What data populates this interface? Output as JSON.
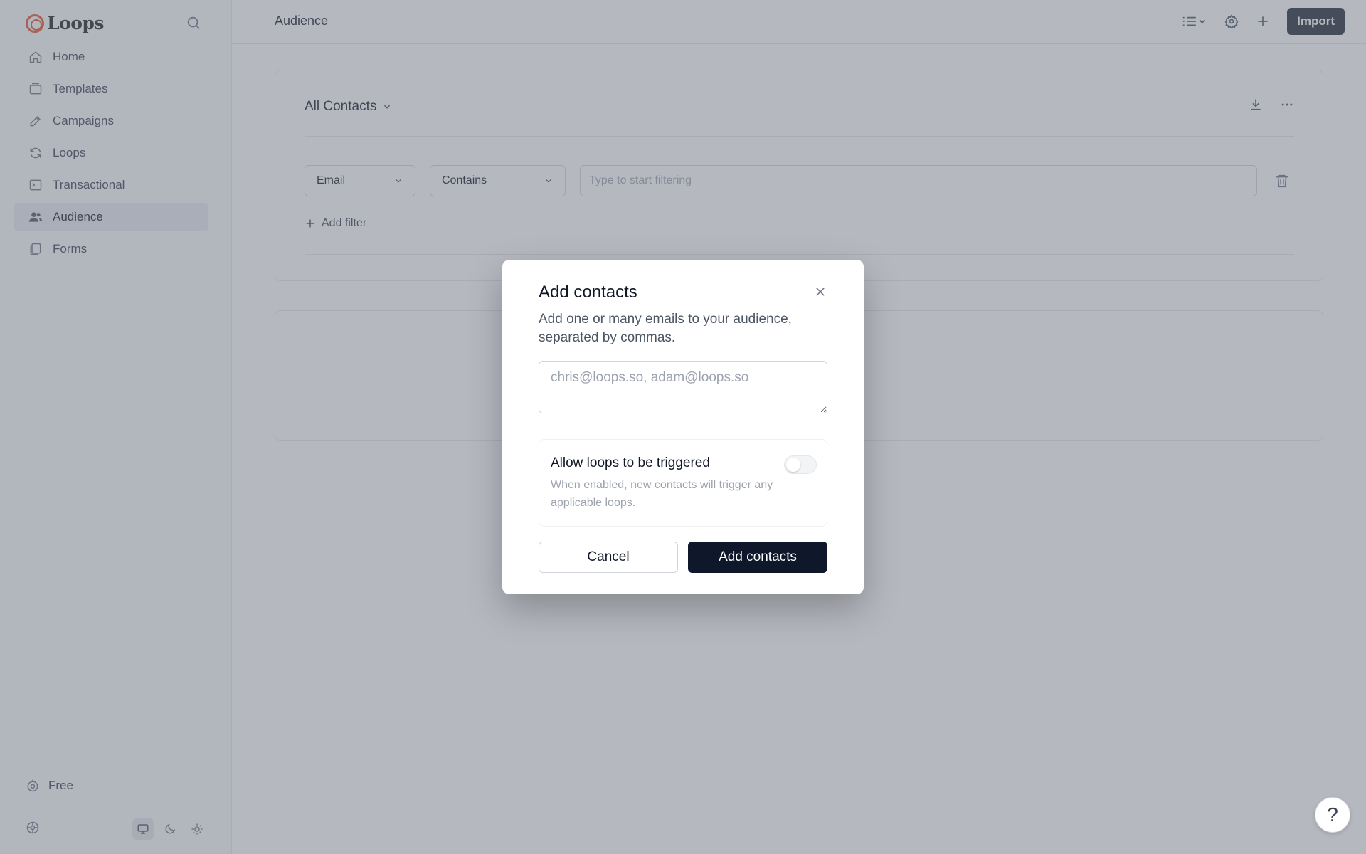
{
  "brand": {
    "name": "Loops"
  },
  "sidebar": {
    "items": [
      {
        "label": "Home",
        "icon": "home-icon"
      },
      {
        "label": "Templates",
        "icon": "templates-icon"
      },
      {
        "label": "Campaigns",
        "icon": "campaigns-icon"
      },
      {
        "label": "Loops",
        "icon": "loops-icon"
      },
      {
        "label": "Transactional",
        "icon": "transactional-icon"
      },
      {
        "label": "Audience",
        "icon": "audience-icon",
        "active": true
      },
      {
        "label": "Forms",
        "icon": "forms-icon"
      }
    ],
    "plan_label": "Free"
  },
  "header": {
    "title": "Audience",
    "import_label": "Import"
  },
  "main": {
    "view_title": "All Contacts",
    "filter": {
      "field": "Email",
      "operator": "Contains",
      "placeholder": "Type to start filtering"
    },
    "add_filter_label": "Add filter"
  },
  "modal": {
    "title": "Add contacts",
    "description": "Add one or many emails to your audience, separated by commas.",
    "textarea_placeholder": "chris@loops.so, adam@loops.so",
    "toggle_title": "Allow loops to be triggered",
    "toggle_description": "When enabled, new contacts will trigger any applicable loops.",
    "toggle_enabled": false,
    "cancel_label": "Cancel",
    "submit_label": "Add contacts"
  },
  "help_label": "?",
  "colors": {
    "brand": "#e0522f",
    "primary_button": "#0f172a",
    "import_button": "#1f2937"
  }
}
